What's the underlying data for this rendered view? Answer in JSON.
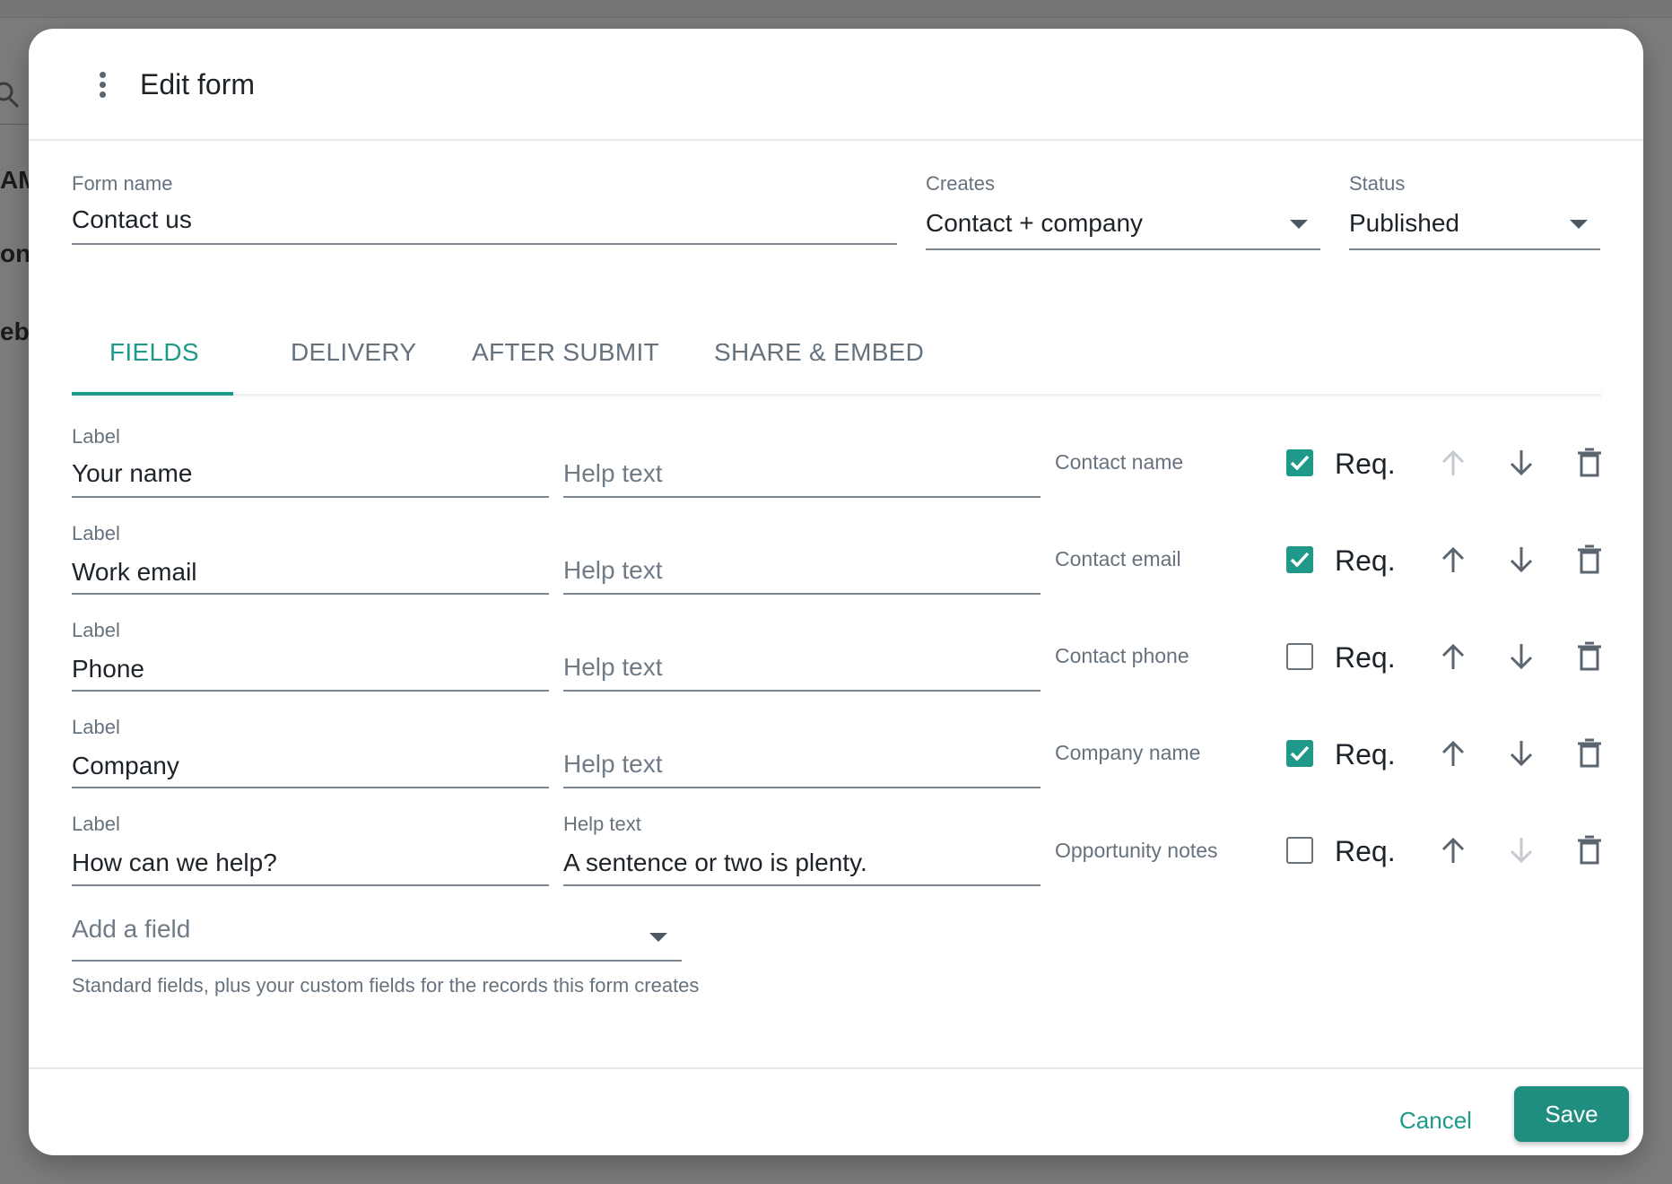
{
  "background": {
    "fragments": [
      "AM",
      "onta",
      "ebi"
    ]
  },
  "dialog": {
    "title": "Edit form",
    "menu_icon": "more-vert-icon"
  },
  "form_name": {
    "label": "Form name",
    "value": "Contact us"
  },
  "creates": {
    "label": "Creates",
    "value": "Contact + company"
  },
  "status": {
    "label": "Status",
    "value": "Published"
  },
  "tabs": [
    {
      "label": "FIELDS",
      "active": true
    },
    {
      "label": "DELIVERY",
      "active": false
    },
    {
      "label": "AFTER SUBMIT",
      "active": false
    },
    {
      "label": "SHARE & EMBED",
      "active": false
    }
  ],
  "fields": [
    {
      "label_caption": "Label",
      "label": "Your name",
      "help_caption": "",
      "help_placeholder": "Help text",
      "help_value": "",
      "mapping": "Contact name",
      "required": true,
      "req_label": "Req.",
      "up_enabled": false,
      "down_enabled": true
    },
    {
      "label_caption": "Label",
      "label": "Work email",
      "help_caption": "",
      "help_placeholder": "Help text",
      "help_value": "",
      "mapping": "Contact email",
      "required": true,
      "req_label": "Req.",
      "up_enabled": true,
      "down_enabled": true
    },
    {
      "label_caption": "Label",
      "label": "Phone",
      "help_caption": "",
      "help_placeholder": "Help text",
      "help_value": "",
      "mapping": "Contact phone",
      "required": false,
      "req_label": "Req.",
      "up_enabled": true,
      "down_enabled": true
    },
    {
      "label_caption": "Label",
      "label": "Company",
      "help_caption": "",
      "help_placeholder": "Help text",
      "help_value": "",
      "mapping": "Company name",
      "required": true,
      "req_label": "Req.",
      "up_enabled": true,
      "down_enabled": true
    },
    {
      "label_caption": "Label",
      "label": "How can we help?",
      "help_caption": "Help text",
      "help_placeholder": "",
      "help_value": "A sentence or two is plenty.",
      "mapping": "Opportunity notes",
      "required": false,
      "req_label": "Req.",
      "up_enabled": true,
      "down_enabled": false
    }
  ],
  "add_field": {
    "placeholder": "Add a field",
    "helper": "Standard fields, plus your custom fields for the records this form creates"
  },
  "footer": {
    "cancel_label": "Cancel",
    "save_label": "Save"
  },
  "colors": {
    "accent": "#1f9a8a",
    "save_button": "#1f8e80",
    "icon_enabled": "#5a6570",
    "icon_disabled": "#c5cbd0"
  }
}
